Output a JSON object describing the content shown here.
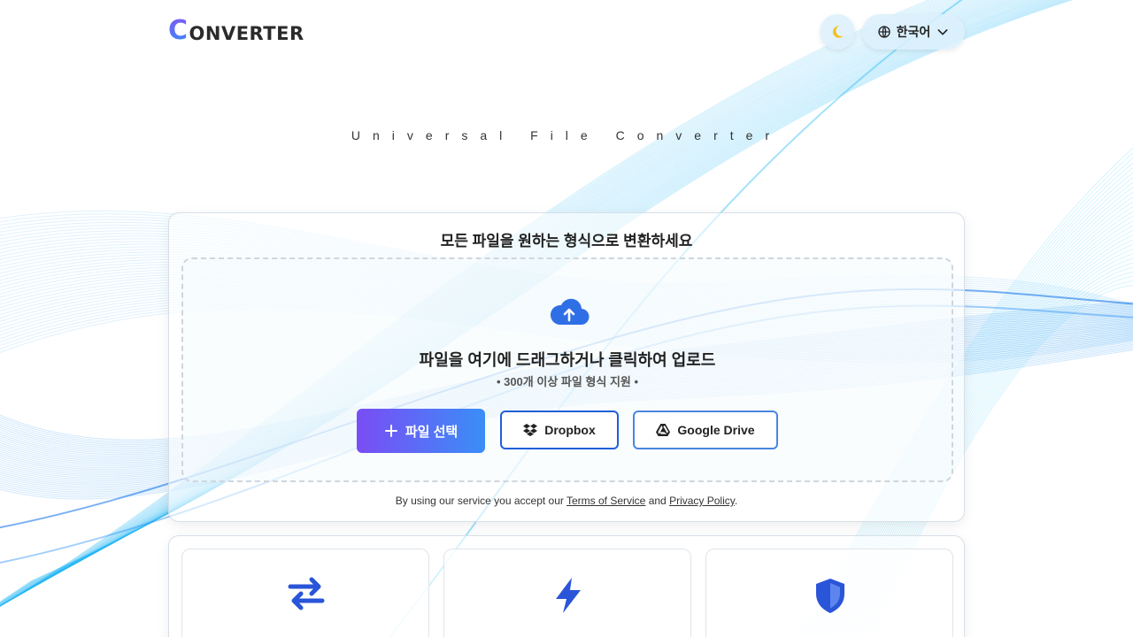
{
  "header": {
    "logo_initial": "C",
    "logo_rest": "ONVERTER",
    "language": "한국어",
    "theme_icon": "moon-icon",
    "language_icon": "globe-icon"
  },
  "tagline": "Universal File Converter",
  "main": {
    "title": "모든 파일을 원하는 형식으로 변환하세요",
    "drop_title": "파일을 여기에 드래그하거나 클릭하여 업로드",
    "drop_sub": "• 300개 이상 파일 형식 지원 •",
    "upload_icon": "cloud-upload-icon",
    "buttons": {
      "select": "파일 선택",
      "dropbox": "Dropbox",
      "gdrive": "Google Drive"
    },
    "terms": {
      "prefix": "By using our service you accept our ",
      "tos": "Terms of Service",
      "middle": " and ",
      "privacy": "Privacy Policy",
      "suffix": "."
    }
  },
  "features": {
    "icons": [
      "arrows-exchange-icon",
      "lightning-icon",
      "shield-icon"
    ]
  },
  "colors": {
    "accent_blue": "#1f5fd6",
    "gradient_start": "#7a4df5",
    "gradient_end": "#3a8ef7",
    "wave_cyan": "#29c3f5",
    "moon_yellow": "#f2c21b"
  }
}
